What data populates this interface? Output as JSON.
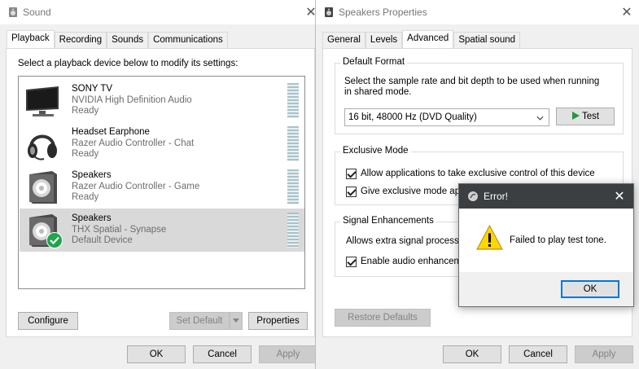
{
  "sound_window": {
    "title": "Sound",
    "tabs": [
      {
        "label": "Playback",
        "active": true
      },
      {
        "label": "Recording",
        "active": false
      },
      {
        "label": "Sounds",
        "active": false
      },
      {
        "label": "Communications",
        "active": false
      }
    ],
    "instruction": "Select a playback device below to modify its settings:",
    "devices": [
      {
        "name": "SONY TV",
        "driver": "NVIDIA High Definition Audio",
        "status": "Ready",
        "icon": "monitor-icon",
        "selected": false
      },
      {
        "name": "Headset Earphone",
        "driver": "Razer Audio Controller - Chat",
        "status": "Ready",
        "icon": "headset-icon",
        "selected": false
      },
      {
        "name": "Speakers",
        "driver": "Razer Audio Controller - Game",
        "status": "Ready",
        "icon": "speaker-icon",
        "selected": false
      },
      {
        "name": "Speakers",
        "driver": "THX Spatial - Synapse",
        "status": "Default Device",
        "icon": "speaker-icon",
        "selected": true,
        "badge": "default-check-icon"
      }
    ],
    "buttons": {
      "configure": "Configure",
      "set_default": "Set Default",
      "properties": "Properties",
      "ok": "OK",
      "cancel": "Cancel",
      "apply": "Apply"
    }
  },
  "speakers_window": {
    "title": "Speakers Properties",
    "tabs": [
      {
        "label": "General",
        "active": false
      },
      {
        "label": "Levels",
        "active": false
      },
      {
        "label": "Advanced",
        "active": true
      },
      {
        "label": "Spatial sound",
        "active": false
      }
    ],
    "default_format": {
      "label": "Default Format",
      "description_line1": "Select the sample rate and bit depth to be used when running",
      "description_line2": "in shared mode.",
      "selected_format": "16 bit, 48000 Hz (DVD Quality)",
      "test_label": "Test"
    },
    "exclusive_mode": {
      "label": "Exclusive Mode",
      "option1": "Allow applications to take exclusive control of this device",
      "option2": "Give exclusive mode app"
    },
    "signal_enhancements": {
      "label": "Signal Enhancements",
      "description": "Allows extra signal processi",
      "option": "Enable audio enhancem"
    },
    "buttons": {
      "restore_defaults": "Restore Defaults",
      "ok": "OK",
      "cancel": "Cancel",
      "apply": "Apply"
    }
  },
  "error_dialog": {
    "title": "Error!",
    "message": "Failed to play test tone.",
    "icon": "warning-icon",
    "ok_label": "OK"
  },
  "colors": {
    "accent": "#0078d7",
    "dialog_title_bar": "#3c3f41",
    "warning": "#ffd700",
    "check_badge": "#1ea54d"
  }
}
